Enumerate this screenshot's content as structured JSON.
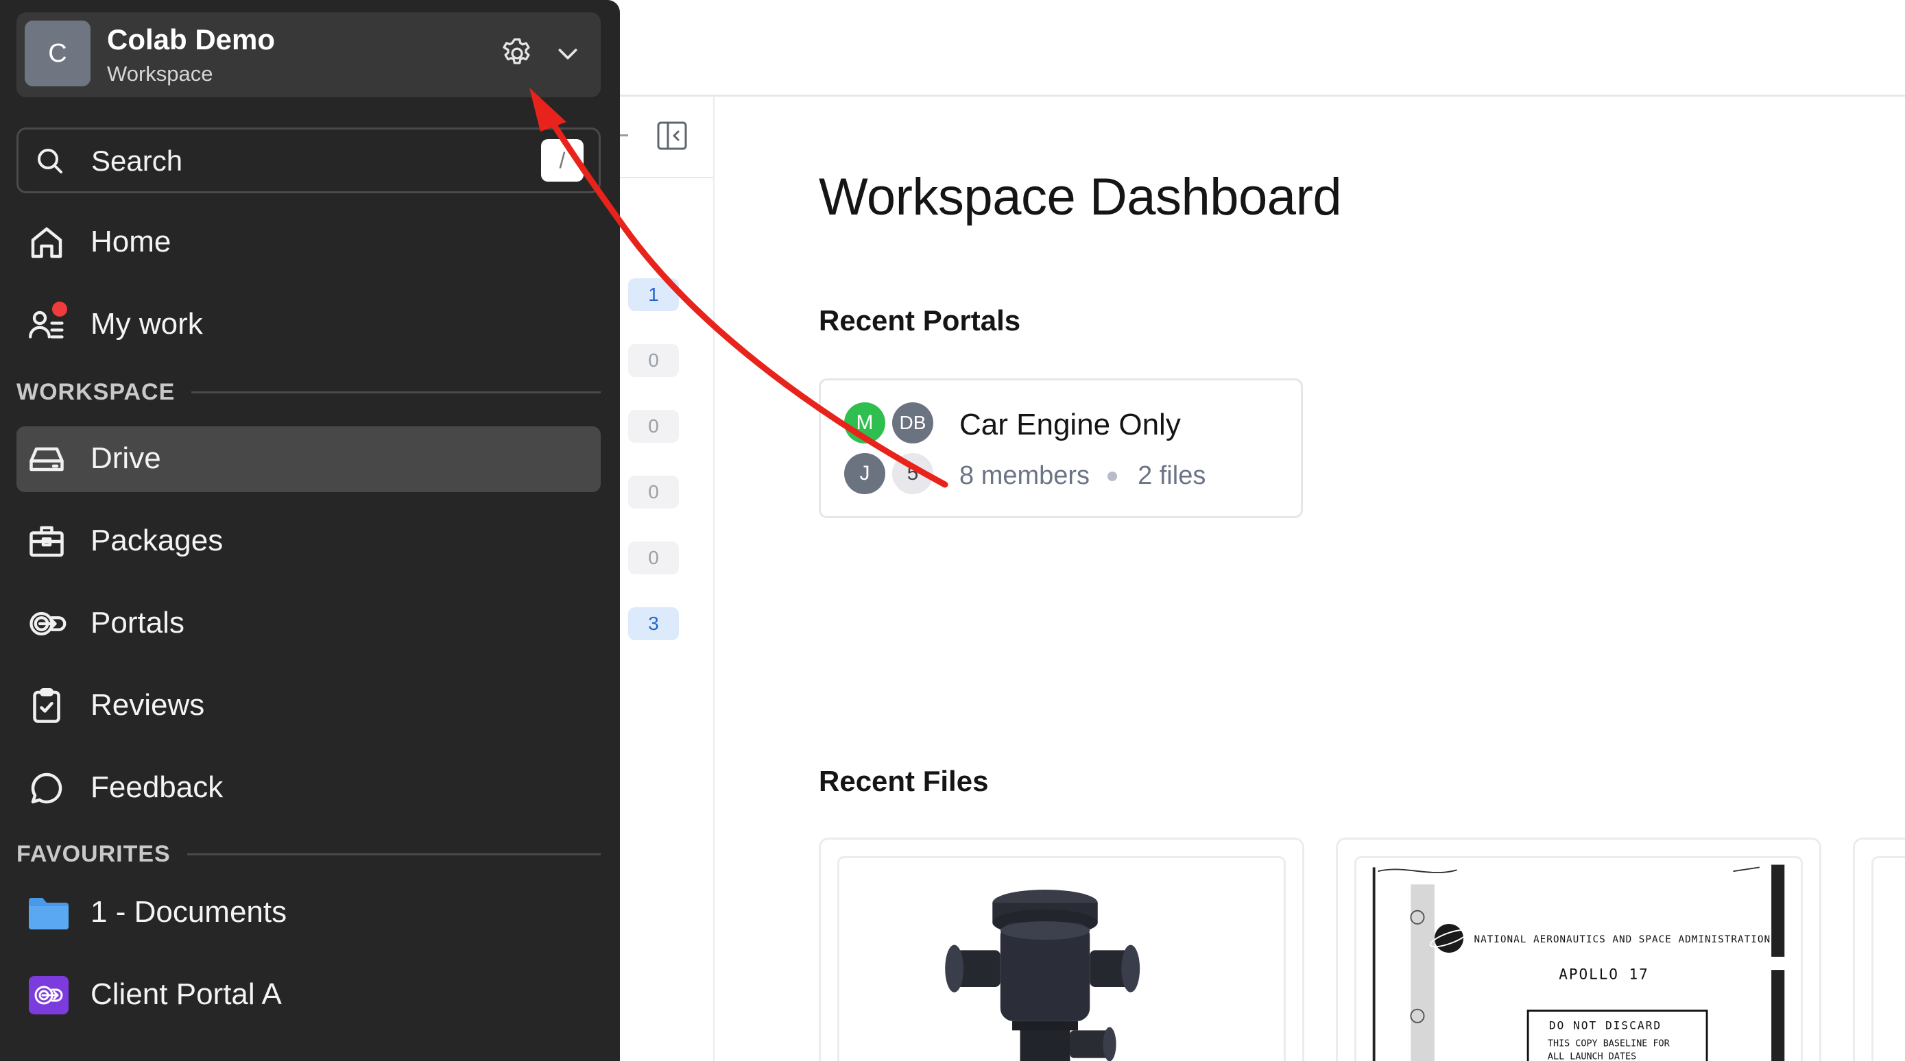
{
  "app": {
    "colors": {
      "sidebar_bg": "#262626",
      "active_item": "#484848",
      "accent_blue": "#2266d0",
      "notification": "#ef3b3b",
      "annotation_arrow": "#e8231b"
    }
  },
  "workspace": {
    "avatar_letter": "C",
    "name": "Colab Demo",
    "subtitle": "Workspace",
    "settings_icon": "gear-icon",
    "switcher_icon": "chevron-down-icon"
  },
  "search": {
    "placeholder": "Search",
    "shortcut": "/"
  },
  "nav": {
    "primary": [
      {
        "label": "Home",
        "icon": "home-icon"
      },
      {
        "label": "My work",
        "icon": "my-work-icon",
        "has_notification": true
      }
    ],
    "workspace_heading": "WORKSPACE",
    "workspace_items": [
      {
        "label": "Drive",
        "icon": "drive-icon",
        "active": true
      },
      {
        "label": "Packages",
        "icon": "package-icon"
      },
      {
        "label": "Portals",
        "icon": "portal-icon"
      },
      {
        "label": "Reviews",
        "icon": "review-icon"
      },
      {
        "label": "Feedback",
        "icon": "feedback-icon"
      }
    ],
    "favourites_heading": "FAVOURITES",
    "favourites": [
      {
        "label": "1 - Documents",
        "icon": "folder-icon"
      },
      {
        "label": "Client Portal A",
        "icon": "portal-icon"
      }
    ]
  },
  "subnav": {
    "counts": [
      "1",
      "0",
      "0",
      "0",
      "0",
      "3"
    ]
  },
  "dashboard": {
    "title": "Workspace Dashboard",
    "recent_portals_heading": "Recent Portals",
    "portal": {
      "name": "Car Engine Only",
      "members": "8 members",
      "files": "2 files",
      "avatars": [
        "M",
        "DB",
        "J",
        "5"
      ]
    },
    "recent_files_heading": "Recent Files",
    "files": [
      {
        "thumbnail": "pump-3d-model"
      },
      {
        "thumbnail": "apollo-17-document",
        "lines": [
          "NATIONAL AERONAUTICS AND SPACE ADMINISTRATION",
          "APOLLO 17",
          "DO NOT DISCARD",
          "THIS COPY BASELINE FOR",
          "ALL LAUNCH DATES"
        ]
      }
    ]
  }
}
